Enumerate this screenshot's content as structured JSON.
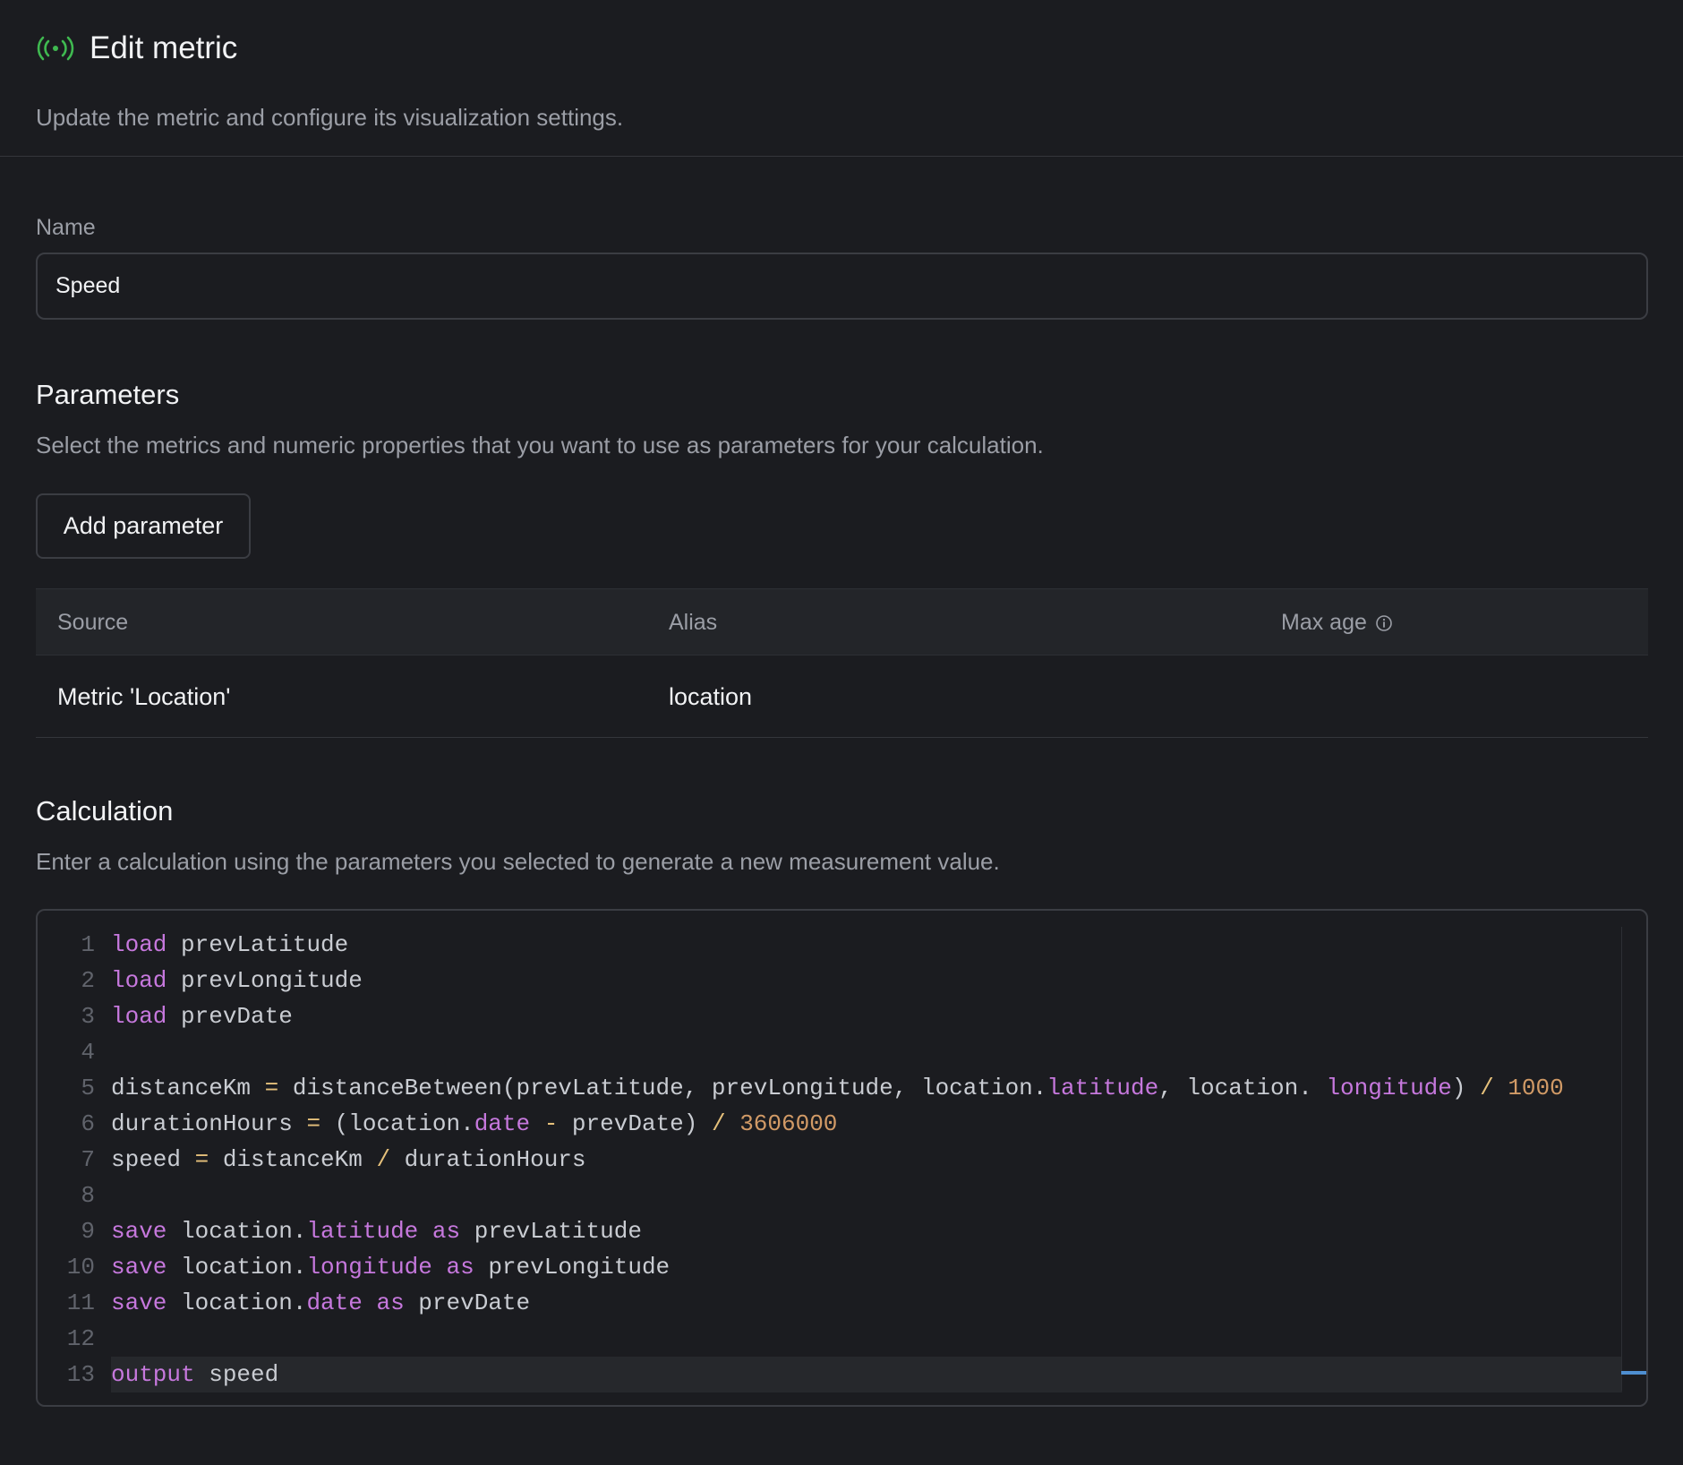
{
  "header": {
    "title": "Edit metric",
    "subtitle": "Update the metric and configure its visualization settings.",
    "icon": "broadcast-icon",
    "icon_color": "#3fb950"
  },
  "form": {
    "name_label": "Name",
    "name_value": "Speed"
  },
  "parameters": {
    "title": "Parameters",
    "description": "Select the metrics and numeric properties that you want to use as parameters for your calculation.",
    "add_button": "Add parameter",
    "columns": [
      "Source",
      "Alias",
      "Max age"
    ],
    "rows": [
      {
        "source": "Metric 'Location'",
        "alias": "location",
        "max_age": ""
      }
    ]
  },
  "calculation": {
    "title": "Calculation",
    "description": "Enter a calculation using the parameters you selected to generate a new measurement value.",
    "active_line": 13,
    "lines": [
      [
        [
          "kw",
          "load"
        ],
        [
          "id",
          " prevLatitude"
        ]
      ],
      [
        [
          "kw",
          "load"
        ],
        [
          "id",
          " prevLongitude"
        ]
      ],
      [
        [
          "kw",
          "load"
        ],
        [
          "id",
          " prevDate"
        ]
      ],
      [],
      [
        [
          "id",
          "distanceKm "
        ],
        [
          "op",
          "="
        ],
        [
          "id",
          " distanceBetween(prevLatitude, prevLongitude, location."
        ],
        [
          "prop",
          "latitude"
        ],
        [
          "id",
          ", location. "
        ],
        [
          "prop",
          "longitude"
        ],
        [
          "id",
          ") "
        ],
        [
          "op",
          "/"
        ],
        [
          "id",
          " "
        ],
        [
          "num",
          "1000"
        ]
      ],
      [
        [
          "id",
          "durationHours "
        ],
        [
          "op",
          "="
        ],
        [
          "id",
          " (location."
        ],
        [
          "prop",
          "date"
        ],
        [
          "id",
          " "
        ],
        [
          "op",
          "-"
        ],
        [
          "id",
          " prevDate) "
        ],
        [
          "op",
          "/"
        ],
        [
          "id",
          " "
        ],
        [
          "num",
          "3606000"
        ]
      ],
      [
        [
          "id",
          "speed "
        ],
        [
          "op",
          "="
        ],
        [
          "id",
          " distanceKm "
        ],
        [
          "op",
          "/"
        ],
        [
          "id",
          " durationHours"
        ]
      ],
      [],
      [
        [
          "kw",
          "save"
        ],
        [
          "id",
          " location."
        ],
        [
          "prop",
          "latitude"
        ],
        [
          "id",
          " "
        ],
        [
          "kw",
          "as"
        ],
        [
          "id",
          " prevLatitude"
        ]
      ],
      [
        [
          "kw",
          "save"
        ],
        [
          "id",
          " location."
        ],
        [
          "prop",
          "longitude"
        ],
        [
          "id",
          " "
        ],
        [
          "kw",
          "as"
        ],
        [
          "id",
          " prevLongitude"
        ]
      ],
      [
        [
          "kw",
          "save"
        ],
        [
          "id",
          " location."
        ],
        [
          "prop",
          "date"
        ],
        [
          "id",
          " "
        ],
        [
          "kw",
          "as"
        ],
        [
          "id",
          " prevDate"
        ]
      ],
      [],
      [
        [
          "kw",
          "output"
        ],
        [
          "id",
          " speed"
        ]
      ]
    ]
  }
}
